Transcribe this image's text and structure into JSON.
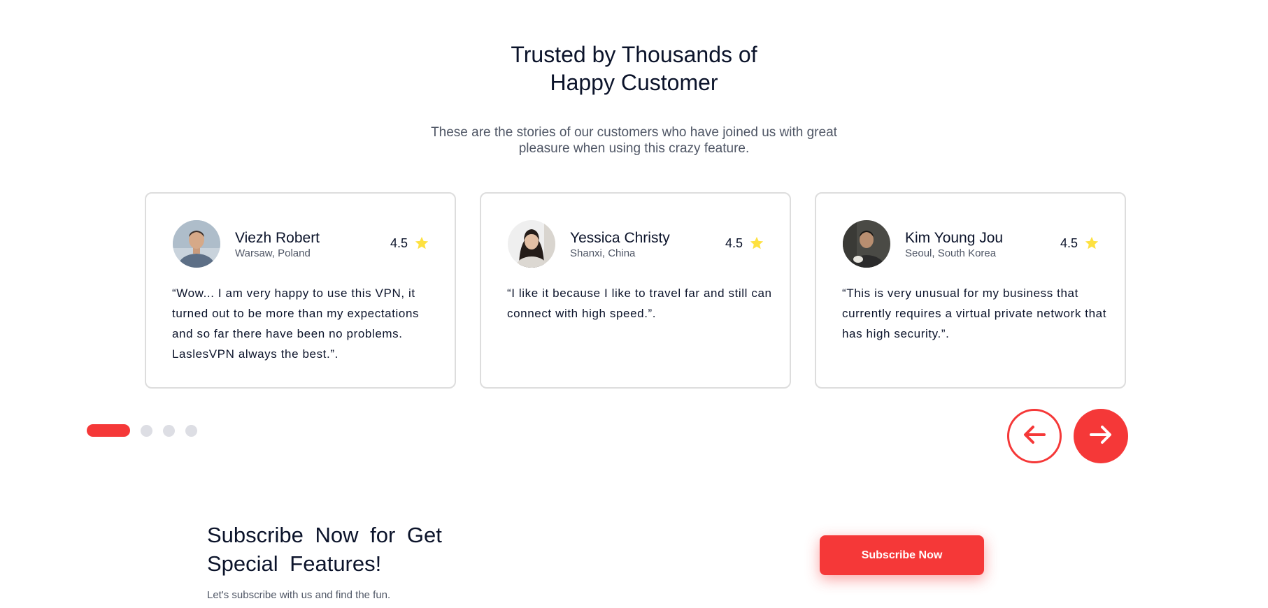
{
  "section": {
    "title_line1": "Trusted by Thousands of",
    "title_line2": "Happy Customer",
    "subtitle_line1": "These are the stories of our customers who have joined us with great",
    "subtitle_line2": "pleasure when using this crazy feature."
  },
  "testimonials": [
    {
      "name": "Viezh Robert",
      "location": "Warsaw, Poland",
      "rating": "4.5",
      "quote": "“Wow... I am very happy to use this VPN, it turned out to be more than my expectations and so far there have been no problems. LaslesVPN always the best.”."
    },
    {
      "name": "Yessica Christy",
      "location": "Shanxi, China",
      "rating": "4.5",
      "quote": "“I like it because I like to travel far and still can connect with high speed.”."
    },
    {
      "name": "Kim Young Jou",
      "location": "Seoul, South Korea",
      "rating": "4.5",
      "quote": "“This is very unusual for my business that currently requires a virtual private network that has high security.”."
    }
  ],
  "pagination": {
    "total": 4,
    "active": 1
  },
  "icons": {
    "star": "star-icon",
    "prev": "arrow-left-icon",
    "next": "arrow-right-icon"
  },
  "colors": {
    "accent": "#F53838",
    "star": "#FEE140",
    "dot_inactive": "#DDDEE4",
    "card_border": "#DDDDDD",
    "text_dark": "#0B132A",
    "text_muted": "#4F5665"
  },
  "subscribe": {
    "title_line1": "Subscribe Now for Get",
    "title_line2": "Special Features!",
    "subtitle": "Let's subscribe with us and find the fun.",
    "button_label": "Subscribe Now"
  }
}
